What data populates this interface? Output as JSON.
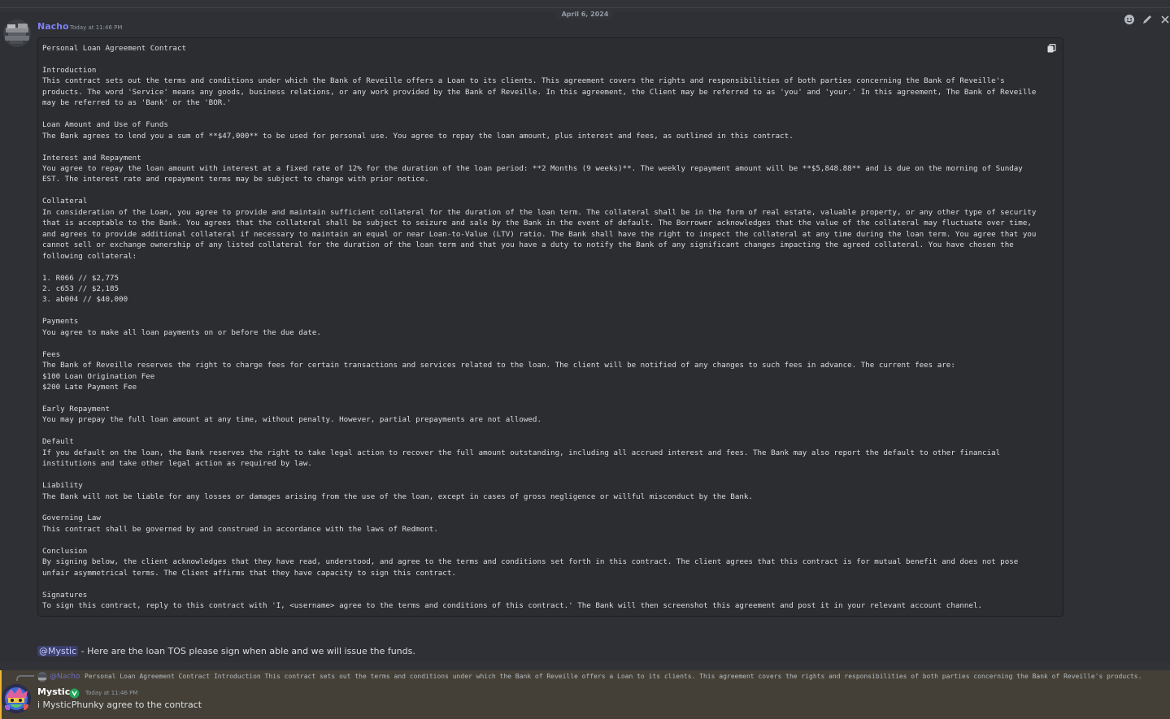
{
  "date_divider": "April 6, 2024",
  "message_1": {
    "author": "Nacho",
    "timestamp": "Today at 11:46 PM",
    "code": "Personal Loan Agreement Contract\n\nIntroduction\nThis contract sets out the terms and conditions under which the Bank of Reveille offers a Loan to its clients. This agreement covers the rights and responsibilities of both parties concerning the Bank of Reveille's products. The word 'Service' means any goods, business relations, or any work provided by the Bank of Reveille. In this agreement, the Client may be referred to as 'you' and 'your.' In this agreement, The Bank of Reveille may be referred to as 'Bank' or the 'BOR.'\n\nLoan Amount and Use of Funds\nThe Bank agrees to lend you a sum of **$47,000** to be used for personal use. You agree to repay the loan amount, plus interest and fees, as outlined in this contract.\n\nInterest and Repayment\nYou agree to repay the loan amount with interest at a fixed rate of 12% for the duration of the loan period: **2 Months (9 weeks)**. The weekly repayment amount will be **$5,848.88** and is due on the morning of Sunday EST. The interest rate and repayment terms may be subject to change with prior notice.\n\nCollateral\nIn consideration of the Loan, you agree to provide and maintain sufficient collateral for the duration of the loan term. The collateral shall be in the form of real estate, valuable property, or any other type of security that is acceptable to the Bank. You agrees that the collateral shall be subject to seizure and sale by the Bank in the event of default. The Borrower acknowledges that the value of the collateral may fluctuate over time, and agrees to provide additional collateral if necessary to maintain an equal or near Loan-to-Value (LTV) ratio. The Bank shall have the right to inspect the collateral at any time during the loan term. You agree that you cannot sell or exchange ownership of any listed collateral for the duration of the loan term and that you have a duty to notify the Bank of any significant changes impacting the agreed collateral. You have chosen the following collateral:\n\n1. R066 // $2,775\n2. c653 // $2,185\n3. ab004 // $40,000\n\nPayments\nYou agree to make all loan payments on or before the due date.\n\nFees\nThe Bank of Reveille reserves the right to charge fees for certain transactions and services related to the loan. The client will be notified of any changes to such fees in advance. The current fees are:\n$100 Loan Origination Fee\n$200 Late Payment Fee\n\nEarly Repayment\nYou may prepay the full loan amount at any time, without penalty. However, partial prepayments are not allowed.\n\nDefault\nIf you default on the loan, the Bank reserves the right to take legal action to recover the full amount outstanding, including all accrued interest and fees. The Bank may also report the default to other financial institutions and take other legal action as required by law.\n\nLiability\nThe Bank will not be liable for any losses or damages arising from the use of the loan, except in cases of gross negligence or willful misconduct by the Bank.\n\nGoverning Law\nThis contract shall be governed by and construed in accordance with the laws of Redmont.\n\nConclusion\nBy signing below, the client acknowledges that they have read, understood, and agree to the terms and conditions set forth in this contract. The client agrees that this contract is for mutual benefit and does not pose unfair asymmetrical terms. The Client affirms that they have capacity to sign this contract.\n\nSignatures\nTo sign this contract, reply to this contract with 'I, <username> agree to the terms and conditions of this contract.' The Bank will then screenshot this agreement and post it in your relevant account channel.",
    "mention": "@Mystic",
    "text_after_mention": " - Here are the loan TOS please sign when able and we will issue the funds."
  },
  "message_2": {
    "reply_author": "@Nacho",
    "reply_preview": "Personal Loan Agreement Contract  Introduction This contract sets out the terms and conditions under which the Bank of Reveille offers a Loan to its clients. This agreement covers the rights and responsibilities of both parties concerning the Bank of Reveille's products.",
    "author": "Mystic",
    "timestamp": "Today at 11:46 PM",
    "text": "i MysticPhunky agree to the contract"
  },
  "icons": {
    "toolbar": [
      "add-reaction-icon",
      "edit-icon",
      "more-icon"
    ],
    "copy": "copy-icon",
    "badge": "server-badge-icon"
  },
  "colors": {
    "background": "#313338",
    "codeblock": "#2b2d31",
    "nacho_name": "#7f7ff7",
    "mention_highlight": "#444037",
    "mention_border": "#f0b232",
    "badge_green": "#23a55a"
  }
}
